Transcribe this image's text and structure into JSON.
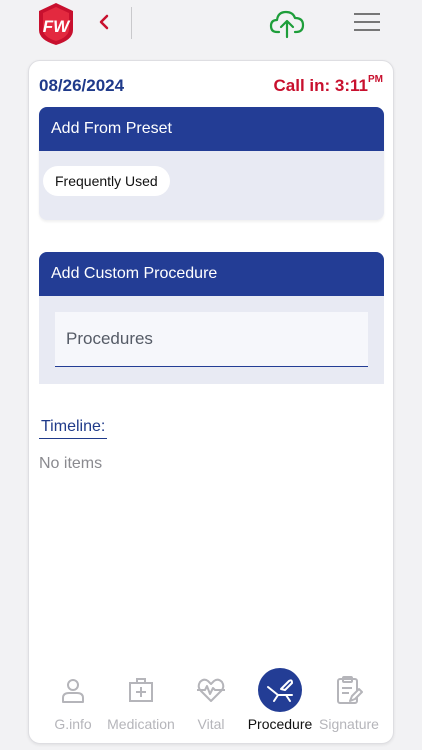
{
  "header": {
    "logo_text": "FW",
    "back_icon": "chevron-left-icon",
    "upload_icon": "cloud-upload-icon",
    "menu_icon": "hamburger-menu-icon"
  },
  "card": {
    "date": "08/26/2024",
    "call_in_label": "Call in: 3:11",
    "call_in_suffix": "PM"
  },
  "preset": {
    "title": "Add From Preset",
    "chip_label": "Frequently Used"
  },
  "custom": {
    "title": "Add Custom Procedure",
    "input_placeholder": "Procedures",
    "input_value": ""
  },
  "timeline": {
    "label": "Timeline:",
    "empty_text": "No items"
  },
  "nav": {
    "items": [
      {
        "label": "G.info",
        "icon": "person-icon"
      },
      {
        "label": "Medication",
        "icon": "medical-kit-icon"
      },
      {
        "label": "Vital",
        "icon": "heart-pulse-icon"
      },
      {
        "label": "Procedure",
        "icon": "procedure-icon"
      },
      {
        "label": "Signature",
        "icon": "clipboard-sign-icon"
      }
    ],
    "active_index": 3
  },
  "colors": {
    "brand_blue": "#233d95",
    "accent_red": "#c8102e",
    "upload_green": "#1e9e3a",
    "inactive_gray": "#b5b5ba"
  }
}
